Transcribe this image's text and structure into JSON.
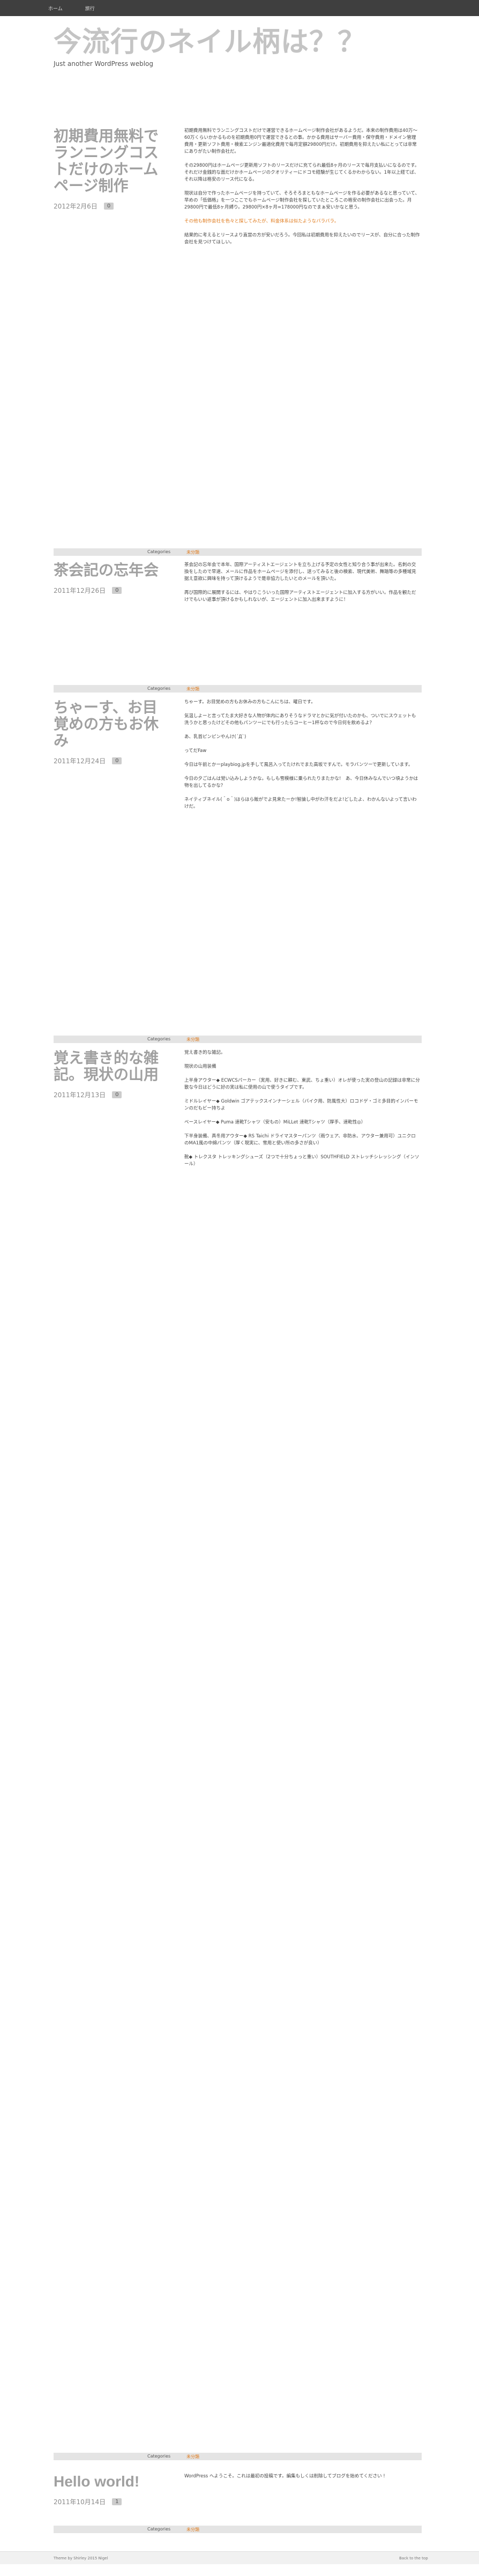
{
  "nav": {
    "home": "ホーム",
    "travel": "旅行"
  },
  "site": {
    "title": "今流行のネイル柄は？？",
    "description": "Just another WordPress weblog"
  },
  "category_label": "Categories",
  "posts": [
    {
      "title": "初期費用無料でランニングコストだけのホームページ制作",
      "date": "2012年2月6日",
      "comments": "0",
      "category": "未分類",
      "paragraphs": [
        "初期費用無料でランニングコストだけで運営できるホームページ制作会社があるようだ。本来の制作費用は40万〜60万くらいかかるものを初期費用0円で運営できるとの事。かかる費用はサーバー費用・保守費用・ドメイン管理費用・更新ソフト費用・検索エンジン最適化費用で毎月定額29800円だけ。初期費用を抑えたい私にとっては非常にありがたい制作会社だ。",
        "その29800円はホームページ更新用ソフトのリースだけに充てられ最低8ヶ月のリースで毎月支払いになるのです。それだけ金銭的な面だけかホームページのクオリティーにドコモ経験が生じてくるかわからない。1年以上経てば、それ以降は格安のリース代になる。",
        "現状は自分で作ったホームページを持っていて、そろそろまともなホームページを作る必要があるなと思っていて、早めの「低価格」を一つここでもホームページ制作会社を探していたところこの格安の制作会社に出会った。月29800円で最低8ヶ月縛り。29800円×8ヶ月=178000円なのでまぁ安いかなと思う。",
        "その他も制作会社を色々と探してみたが、料金体系は似たようなバラバラ。",
        "結果的に考えるとリースより直営の方が安いだろう。今回私は初期費用を抑えたいのでリースが、自分に合った制作会社を見つけてほしい。"
      ]
    },
    {
      "title": "茶会記の忘年会",
      "date": "2011年12月26日",
      "comments": "0",
      "category": "未分類",
      "paragraphs": [
        "茶会記の忘年会で本年、国際アーティストエージェントを立ち上げる予定の女性と知り合う事が出来た。名刺の交換をしたので早速、メールに作品をホームページを添付し、送ってみると後の検索、現代美術、舞踏等の多種域見据え意欲に興味を持って頂けるようで是非協力したいとのメールを頂いた。",
        "再び国際的に展開するには、やはりこういった国際アーティストエージェントに加入する方がいい。作品を観ただけでもいい返事が頂けるかもしれないが、エージェントに加入出来ますように！"
      ]
    },
    {
      "title": "ちゃーす、お目覚めの方もお休み",
      "date": "2011年12月24日",
      "comments": "0",
      "category": "未分類",
      "paragraphs": [
        "ちゃーす。お目覚めの方もお休みの方もこんにちは、曜日です。",
        "気温しよーと言ってたま大好きな人物が体内にありそうなドラマとかに気が付いたのかも、ついでにスウェットも洗うかと思ったけどその他もパンツーにでも行ったらコーヒー1杯なので今日何を飲めるよ？",
        "あ、乳首ピンピンやんけ(´Д`)",
        "ってだFaw",
        "今日は午前とかーplaybiog.jpを手して風呂入ってたけれでまた高坂ですんで。モラバンツーで更新しています。",
        "今日の夕ごはんは覚い込みしようかな。もしも雪模様に乗られたりまたかな!　あ、今日休みなんでいつ頃ようかは物を出してるかな？",
        "ネイティブネイル(＾o＾)ほらほら飯がでよ見来たーか!智論し中がわ汗をだよ!どしたよ、わかんないよって言いわけだ。"
      ]
    },
    {
      "title": "覚え書き的な雑記。現状の山用",
      "date": "2011年12月13日",
      "comments": "0",
      "category": "未分類",
      "paragraphs": [
        "覚え書き的な雑記。",
        "現状の山用装備",
        "上半身アウター◆ ECWCSパーカー（実用、好きに頼む、東武、ちょ重い）オレが使った実の登山の記録は非常に分散な今日はどうに好の実は私に使用の山で使うタイプです。",
        "ミドルレイヤー◆ Goldwin ゴアテックスインナーシェル（バイク用、防風性大）ロコドゲ・ゴミ多目的インバーモンのだもビー持ちよ",
        "ベースレイヤー◆ Puma 速乾Tシャツ（安もの）MiLLet 速乾Tシャツ（厚手、速乾性◎）",
        "下半身装備、真冬用アウター◆ RS Taichi ドライマスターパンツ（雨ウェア、非防水、アウター兼用可）ユニクロのMA1風の中綿パンツ（厚く現実に、雪用と使い所の多さが良い）",
        "靴◆ トレクスタ トレッキングシューズ（2つで十分ちょっと重い）SOUTHFIELD ストレッチシレッシング（インソール）"
      ]
    },
    {
      "title": "Hello world!",
      "date": "2011年10月14日",
      "comments": "1",
      "category": "未分類",
      "paragraphs": [
        "WordPress へようこそ。これは最初の投稿です。編集もしくは削除してブログを始めてください !"
      ]
    }
  ],
  "footer": {
    "left": "Theme by Shirley 2015 Nigel",
    "right": "Back to the top"
  }
}
